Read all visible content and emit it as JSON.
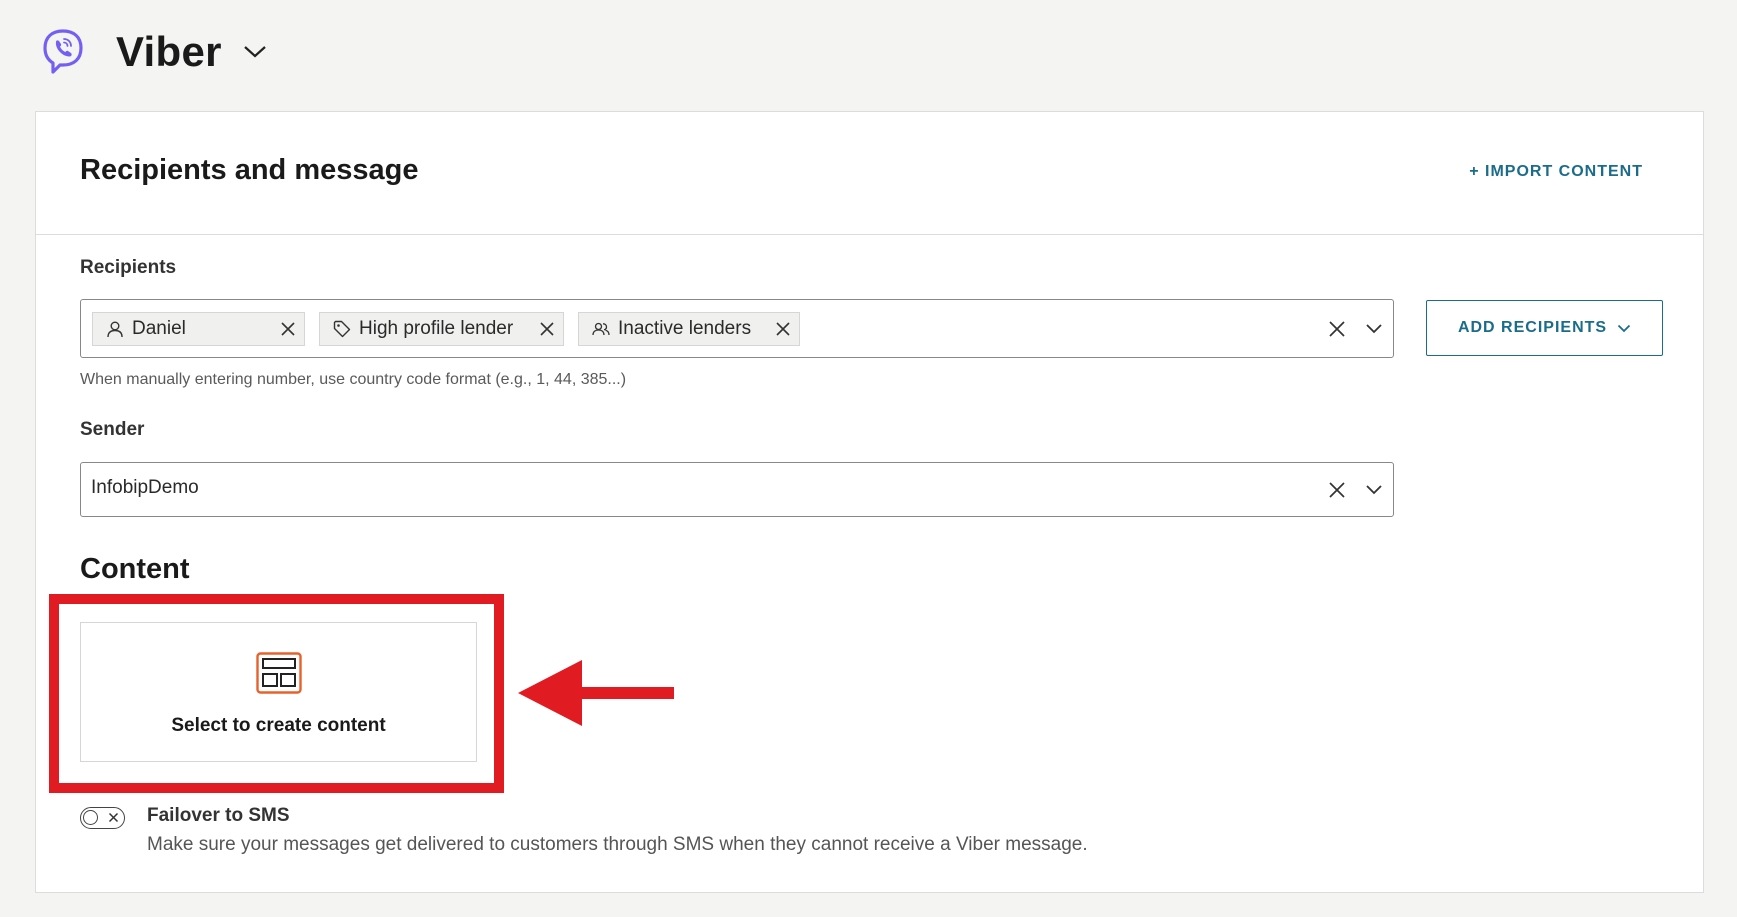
{
  "header": {
    "channel_title": "Viber",
    "logo_icon": "viber-logo-icon",
    "accent_color": "#7360f2"
  },
  "card": {
    "title": "Recipients and message",
    "import_label": "+ IMPORT CONTENT"
  },
  "recipients": {
    "label": "Recipients",
    "chips": [
      {
        "label": "Daniel",
        "icon": "person-icon"
      },
      {
        "label": "High profile lender",
        "icon": "tag-icon"
      },
      {
        "label": "Inactive lenders",
        "icon": "people-icon"
      }
    ],
    "hint": "When manually entering number, use country code format (e.g., 1, 44, 385...)",
    "add_button_label": "ADD RECIPIENTS"
  },
  "sender": {
    "label": "Sender",
    "value": "InfobipDemo"
  },
  "content": {
    "title": "Content",
    "tile_label": "Select to create content",
    "tile_icon": "layout-icon",
    "tile_icon_color": "#e8612c"
  },
  "failover": {
    "label": "Failover to SMS",
    "description": "Make sure your messages get delivered to customers through SMS when they cannot receive a Viber message.",
    "enabled": false
  },
  "colors": {
    "link": "#1a6c8a",
    "highlight": "#e11b22"
  }
}
